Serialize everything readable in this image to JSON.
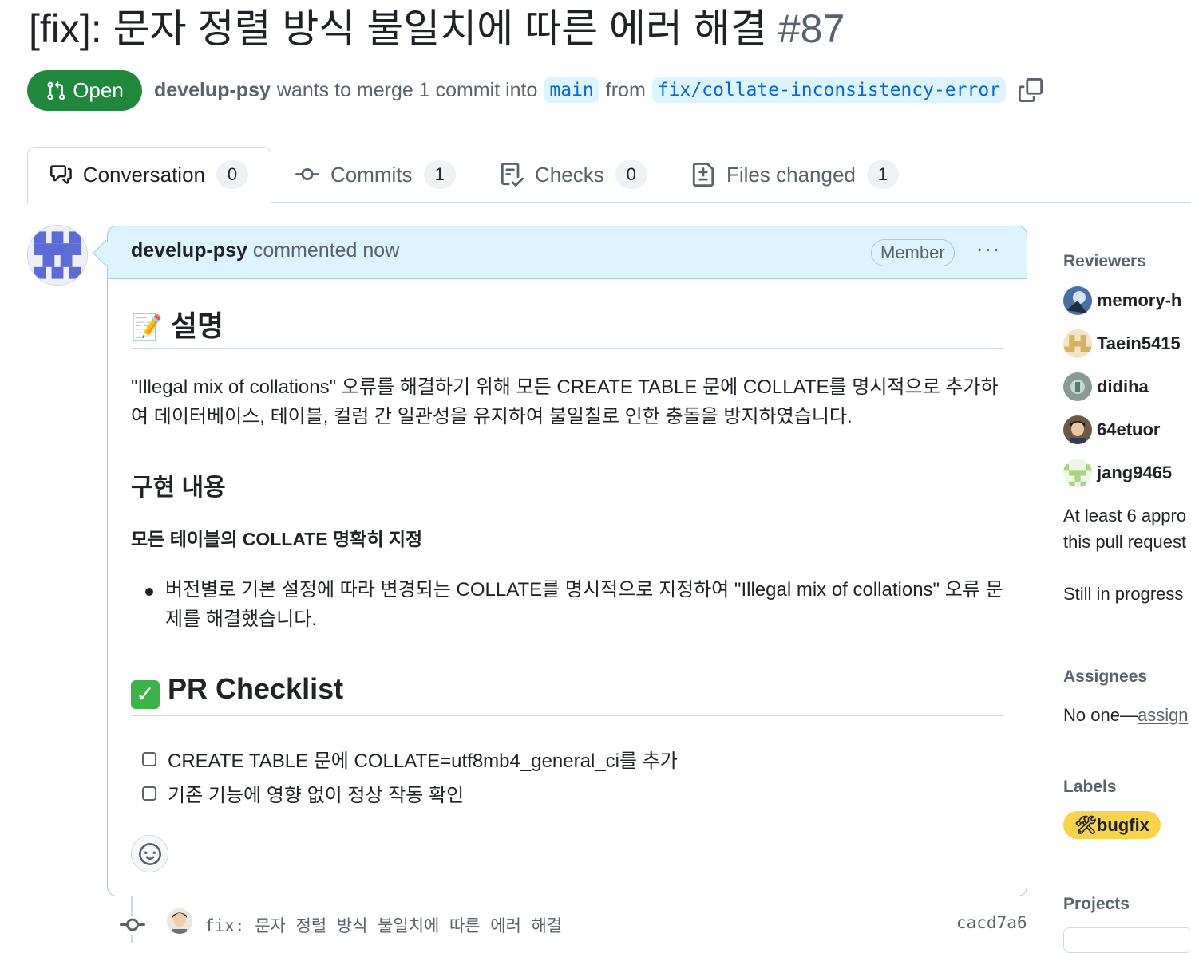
{
  "pr": {
    "title": "[fix]: 문자 정렬 방식 불일치에 따른 에러 해결",
    "number": "#87",
    "state": "Open",
    "author": "develup-psy",
    "merge_text": "wants to merge 1 commit into",
    "base_branch": "main",
    "from_text": "from",
    "head_branch": "fix/collate-inconsistency-error"
  },
  "tabs": [
    {
      "label": "Conversation",
      "count": "0",
      "icon": "conversation-icon"
    },
    {
      "label": "Commits",
      "count": "1",
      "icon": "commit-icon"
    },
    {
      "label": "Checks",
      "count": "0",
      "icon": "checklist-icon"
    },
    {
      "label": "Files changed",
      "count": "1",
      "icon": "file-diff-icon"
    }
  ],
  "comment": {
    "author": "develup-psy",
    "action": "commented now",
    "badge": "Member",
    "more": "···",
    "body": {
      "heading1_emoji": "📝",
      "heading1": "설명",
      "paragraph": "\"Illegal mix of collations\" 오류를 해결하기 위해 모든 CREATE TABLE 문에 COLLATE를 명시적으로 추가하여 데이터베이스, 테이블, 컬럼 간 일관성을 유지하여 불일칠로 인한 충돌을 방지하였습니다.",
      "heading2": "구현 내용",
      "heading3": "모든 테이블의 COLLATE 명확히 지정",
      "bullet": "버전별로 기본 설정에 따라 변경되는 COLLATE를 명시적으로 지정하여 \"Illegal mix of collations\" 오류 문제를 해결했습니다.",
      "heading4_emoji": "✅",
      "heading4": "PR Checklist",
      "checklist": [
        "CREATE TABLE 문에 COLLATE=utf8mb4_general_ci를 추가",
        "기존 기능에 영향 없이 정상 작동 확인"
      ]
    }
  },
  "timeline_commit": {
    "message": "fix: 문자 정렬 방식 불일치에 따른 에러 해결",
    "sha": "cacd7a6"
  },
  "sidebar": {
    "reviewers_heading": "Reviewers",
    "reviewers": [
      "memory-h",
      "Taein5415",
      "didiha",
      "64etuor",
      "jang9465"
    ],
    "approval_note_1": "At least 6 appro",
    "approval_note_2": "this pull request",
    "still_in_progress": "Still in progress",
    "assignees_heading": "Assignees",
    "assignees_none": "No one—",
    "assign_link": "assign",
    "labels_heading": "Labels",
    "label": "🛠bugfix",
    "projects_heading": "Projects"
  },
  "colors": {
    "open_green": "#1f883d",
    "link_blue": "#0969da",
    "branch_bg": "#ddf4ff",
    "label_yellow": "#f9d34a"
  }
}
